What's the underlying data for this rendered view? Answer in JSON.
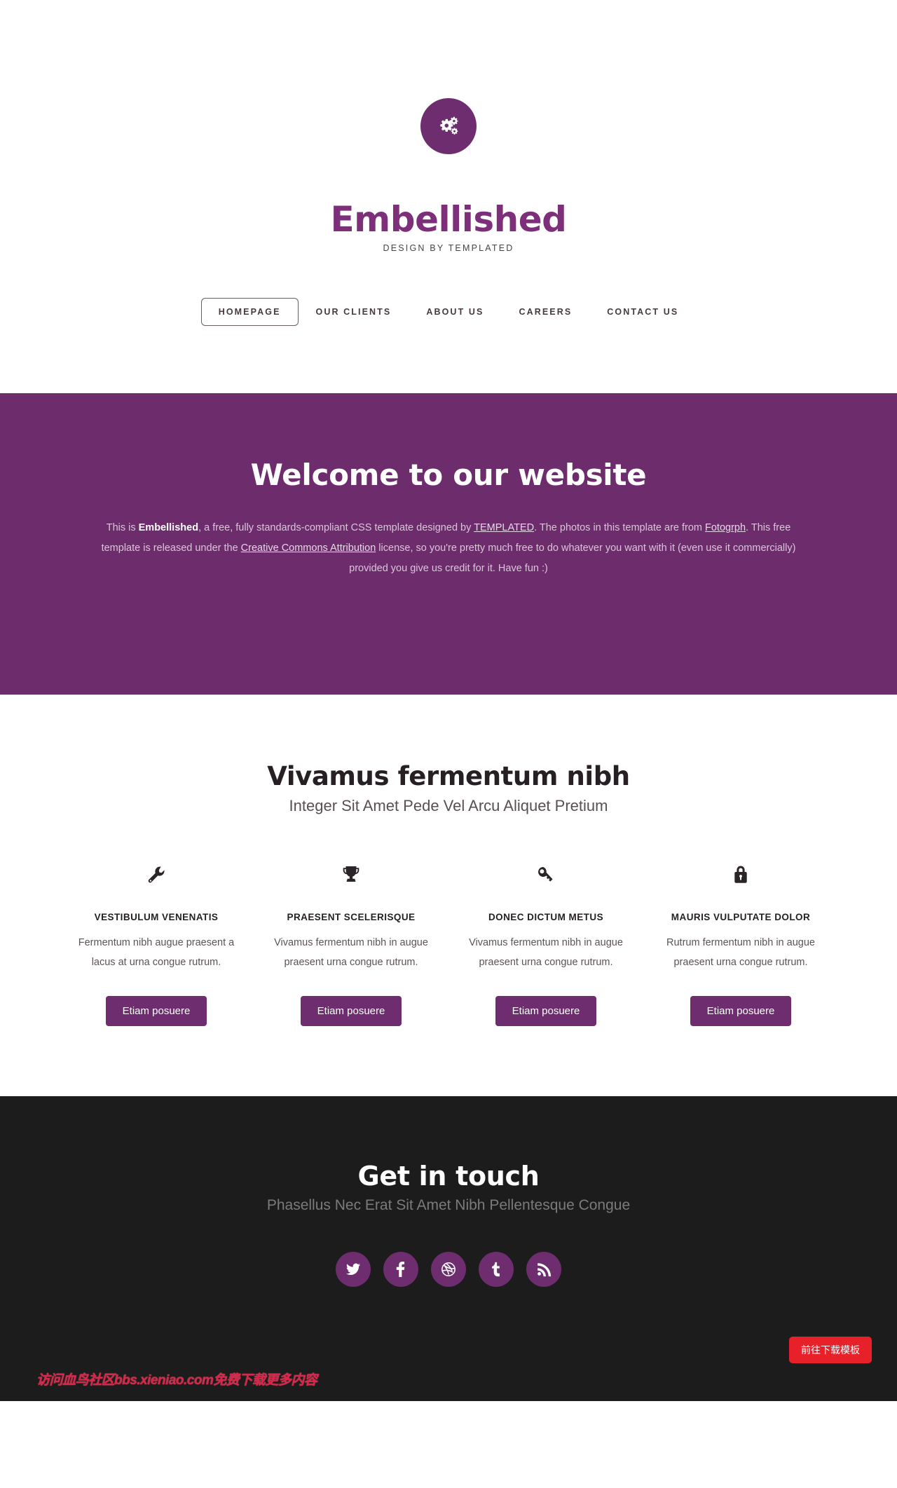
{
  "header": {
    "logo_icon": "gears-icon",
    "title": "Embellished",
    "tagline": "DESIGN BY TEMPLATED"
  },
  "nav": {
    "items": [
      {
        "label": "HOMEPAGE",
        "active": true
      },
      {
        "label": "OUR CLIENTS",
        "active": false
      },
      {
        "label": "ABOUT US",
        "active": false
      },
      {
        "label": "CAREERS",
        "active": false
      },
      {
        "label": "CONTACT US",
        "active": false
      }
    ]
  },
  "banner": {
    "heading": "Welcome to our website",
    "p1_a": "This is ",
    "p1_strong": "Embellished",
    "p1_b": ", a free, fully standards-compliant CSS template designed by ",
    "link_templated": "TEMPLATED",
    "p1_c": ". The photos in this template are from ",
    "link_fotogrph": "Fotogrph",
    "p1_d": ". This free template is released under the ",
    "link_cc": "Creative Commons Attribution",
    "p1_e": " license, so you're pretty much free to do whatever you want with it (even use it commercially) provided you give us credit for it. Have fun :)"
  },
  "features": {
    "heading": "Vivamus fermentum nibh",
    "subheading": "Integer Sit Amet Pede Vel Arcu Aliquet Pretium",
    "boxes": [
      {
        "icon": "wrench-icon",
        "title": "VESTIBULUM VENENATIS",
        "text": "Fermentum nibh augue praesent a lacus at urna congue rutrum.",
        "button": "Etiam posuere"
      },
      {
        "icon": "trophy-icon",
        "title": "PRAESENT SCELERISQUE",
        "text": "Vivamus fermentum nibh in augue praesent urna congue rutrum.",
        "button": "Etiam posuere"
      },
      {
        "icon": "key-icon",
        "title": "DONEC DICTUM METUS",
        "text": "Vivamus fermentum nibh in augue praesent urna congue rutrum.",
        "button": "Etiam posuere"
      },
      {
        "icon": "lock-icon",
        "title": "MAURIS VULPUTATE DOLOR",
        "text": "Rutrum fermentum nibh in augue praesent urna congue rutrum.",
        "button": "Etiam posuere"
      }
    ]
  },
  "footer": {
    "heading": "Get in touch",
    "subheading": "Phasellus Nec Erat Sit Amet Nibh Pellentesque Congue",
    "socials": [
      {
        "name": "twitter-icon"
      },
      {
        "name": "facebook-icon"
      },
      {
        "name": "dribbble-icon"
      },
      {
        "name": "tumblr-icon"
      },
      {
        "name": "rss-icon"
      }
    ]
  },
  "overlay": {
    "watermark": "访问血鸟社区bbs.xieniao.com免费下载更多内容",
    "download_button": "前往下载模板"
  },
  "colors": {
    "purple": "#6e2d6e",
    "title_purple": "#7d2f79",
    "dark": "#1c1c1c",
    "red": "#e8202a",
    "watermark_red": "#d9254a"
  }
}
